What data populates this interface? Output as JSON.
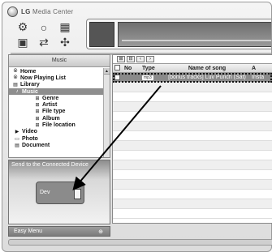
{
  "app": {
    "title": "LG",
    "subtitle": "Media Center"
  },
  "toolbar": {
    "icons": [
      {
        "name": "settings-icon",
        "glyph": "⚙"
      },
      {
        "name": "search-icon",
        "glyph": "○"
      },
      {
        "name": "library-icon",
        "glyph": "▦"
      },
      {
        "name": "device-icon",
        "glyph": "▣"
      },
      {
        "name": "sync-icon",
        "glyph": "⇄"
      },
      {
        "name": "disc-icon",
        "glyph": "✣"
      }
    ]
  },
  "sidebar": {
    "header": "Music",
    "items": [
      {
        "label": "Home",
        "glyph": "⦾",
        "level": 0
      },
      {
        "label": "Now Playing List",
        "glyph": "⦾",
        "level": 0
      },
      {
        "label": "Library",
        "glyph": "▤",
        "level": 0
      },
      {
        "label": "Music",
        "glyph": "♪",
        "level": 1,
        "selected": true
      },
      {
        "label": "Genre",
        "glyph": "⊞",
        "level": 2
      },
      {
        "label": "Artist",
        "glyph": "⊞",
        "level": 2
      },
      {
        "label": "File type",
        "glyph": "⊞",
        "level": 2
      },
      {
        "label": "Album",
        "glyph": "⊞",
        "level": 2
      },
      {
        "label": "File location",
        "glyph": "⊞",
        "level": 2
      },
      {
        "label": "Video",
        "glyph": "▶",
        "level": 1
      },
      {
        "label": "Photo",
        "glyph": "▭",
        "level": 1
      },
      {
        "label": "Document",
        "glyph": "▤",
        "level": 1
      }
    ]
  },
  "send_panel": {
    "title": "Send to the Connected Device",
    "device_label": "Dev"
  },
  "easy_menu": {
    "label": "Easy Menu",
    "icon": "⊕"
  },
  "list": {
    "nav": [
      "⊞",
      "⊟",
      "‹",
      "›"
    ],
    "columns": {
      "no": "No",
      "type": "Type",
      "name": "Name of song",
      "artist": "A"
    },
    "rows": [
      {
        "no": "1",
        "type": "mp3",
        "name": "[bonus tracks] Luv Punch (Sat)",
        "artist": "Insta"
      }
    ]
  }
}
